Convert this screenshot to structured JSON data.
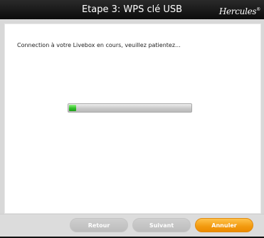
{
  "window": {
    "title": "Etape 3: WPS clé USB",
    "brand": "Hercules",
    "brand_mark": "®"
  },
  "content": {
    "message": "Connection à votre Livebox en cours, veuillez patientez...",
    "progress": 0.06
  },
  "buttons": {
    "back_label": "Retour",
    "next_label": "Suivant",
    "cancel_label": "Annuler"
  },
  "colors": {
    "titlebar": "#111111",
    "accent": "#f29a0f",
    "progress": "#2fbf27",
    "disabled_button": "#c8c8c8"
  }
}
